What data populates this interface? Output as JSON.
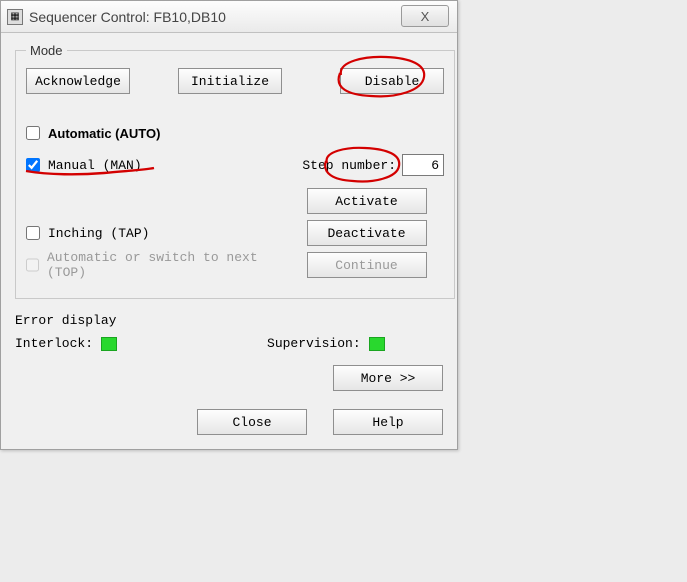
{
  "titlebar": {
    "title": "Sequencer Control: FB10,DB10",
    "close_label": "X"
  },
  "mode": {
    "legend": "Mode",
    "acknowledge": "Acknowledge",
    "initialize": "Initialize",
    "disable": "Disable",
    "automatic_label": "Automatic (AUTO)",
    "automatic_checked": false,
    "manual_label": "Manual (MAN)",
    "manual_checked": true,
    "inching_label": "Inching (TAP)",
    "inching_checked": false,
    "auto_switch_label": "Automatic or switch to next (TOP)",
    "auto_switch_checked": false,
    "step_label": "Step number:",
    "step_value": "6",
    "activate": "Activate",
    "deactivate": "Deactivate",
    "continue": "Continue"
  },
  "error": {
    "title": "Error display",
    "interlock": "Interlock:",
    "supervision": "Supervision:",
    "indicator_color": "#29d82e"
  },
  "buttons": {
    "more": "More >>",
    "close": "Close",
    "help": "Help"
  }
}
